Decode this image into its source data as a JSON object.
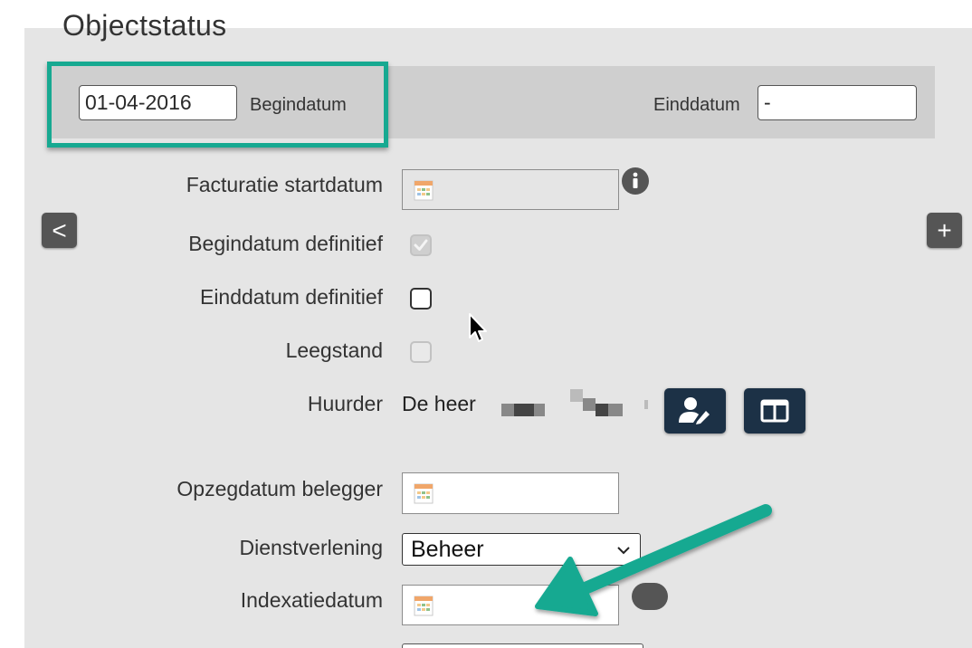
{
  "header": {
    "title": "Objectstatus"
  },
  "dates": {
    "begin_value": "01-04-2016",
    "begin_label": "Begindatum",
    "end_label": "Einddatum",
    "end_value": "-"
  },
  "nav": {
    "prev_label": "<",
    "add_label": "+"
  },
  "form": {
    "facturatie_label": "Facturatie startdatum",
    "begindatum_definitief_label": "Begindatum definitief",
    "einddatum_definitief_label": "Einddatum definitief",
    "leegstand_label": "Leegstand",
    "huurder_label": "Huurder",
    "huurder_value": "De heer",
    "opzegdatum_label": "Opzegdatum belegger",
    "dienstverlening_label": "Dienstverlening",
    "dienstverlening_value": "Beheer",
    "indexatiedatum_label": "Indexatiedatum"
  },
  "checkboxes": {
    "begindatum_definitief": true,
    "einddatum_definitief": false,
    "leegstand": false
  },
  "icons": {
    "info": "info-icon",
    "calendar": "calendar-icon",
    "edit_user": "user-edit-icon",
    "columns": "columns-icon",
    "chevron": "chevron-down-icon",
    "cursor": "mouse-cursor-icon",
    "arrow": "annotation-arrow"
  },
  "colors": {
    "highlight": "#17a991",
    "dark_button": "#1c3146",
    "panel": "#e5e5e5",
    "band": "#cfcfcf"
  }
}
